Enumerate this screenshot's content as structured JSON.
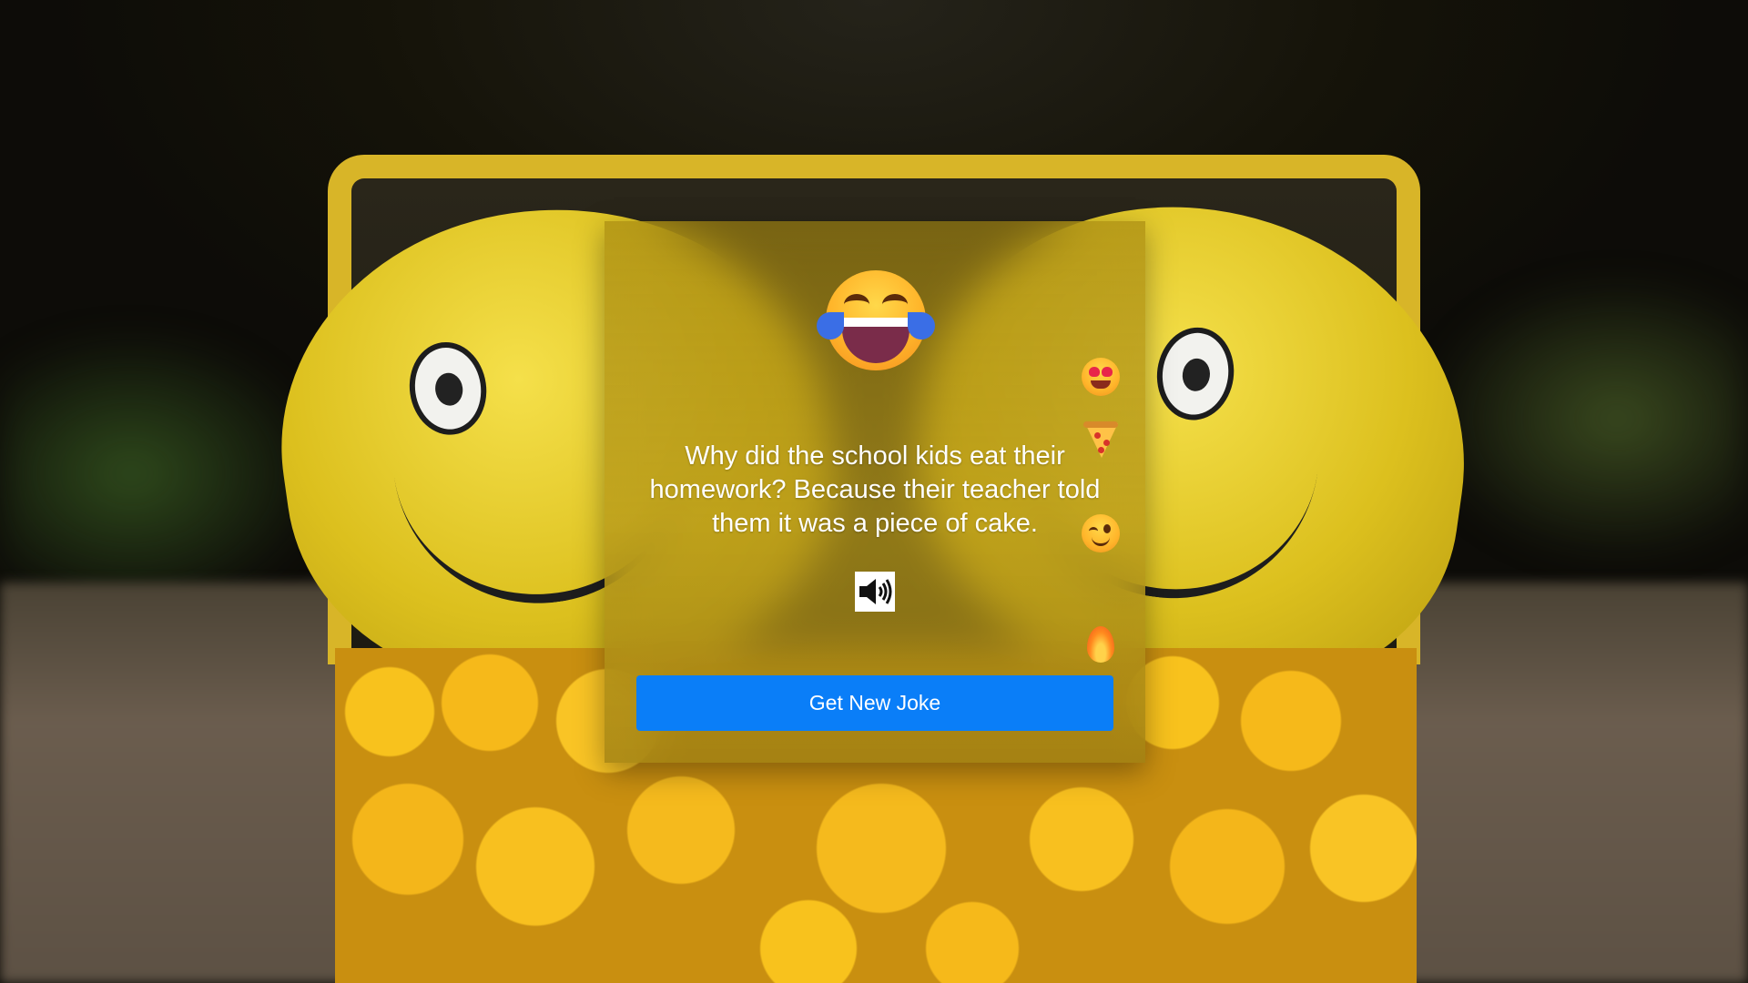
{
  "joke": {
    "text": "Why did the school kids eat their homework? Because their teacher told them it was a piece of cake."
  },
  "actions": {
    "new_joke_label": "Get New Joke"
  },
  "decorations": {
    "hero_icon": "face-with-tears-of-joy",
    "side_icons": [
      "heart-eyes-face",
      "pizza-slice",
      "winking-face",
      "fire"
    ]
  },
  "colors": {
    "button_bg": "#0a7ef8",
    "button_text": "#ffffff",
    "joke_text": "#ffffff",
    "card_tint": "#aa8c14"
  }
}
